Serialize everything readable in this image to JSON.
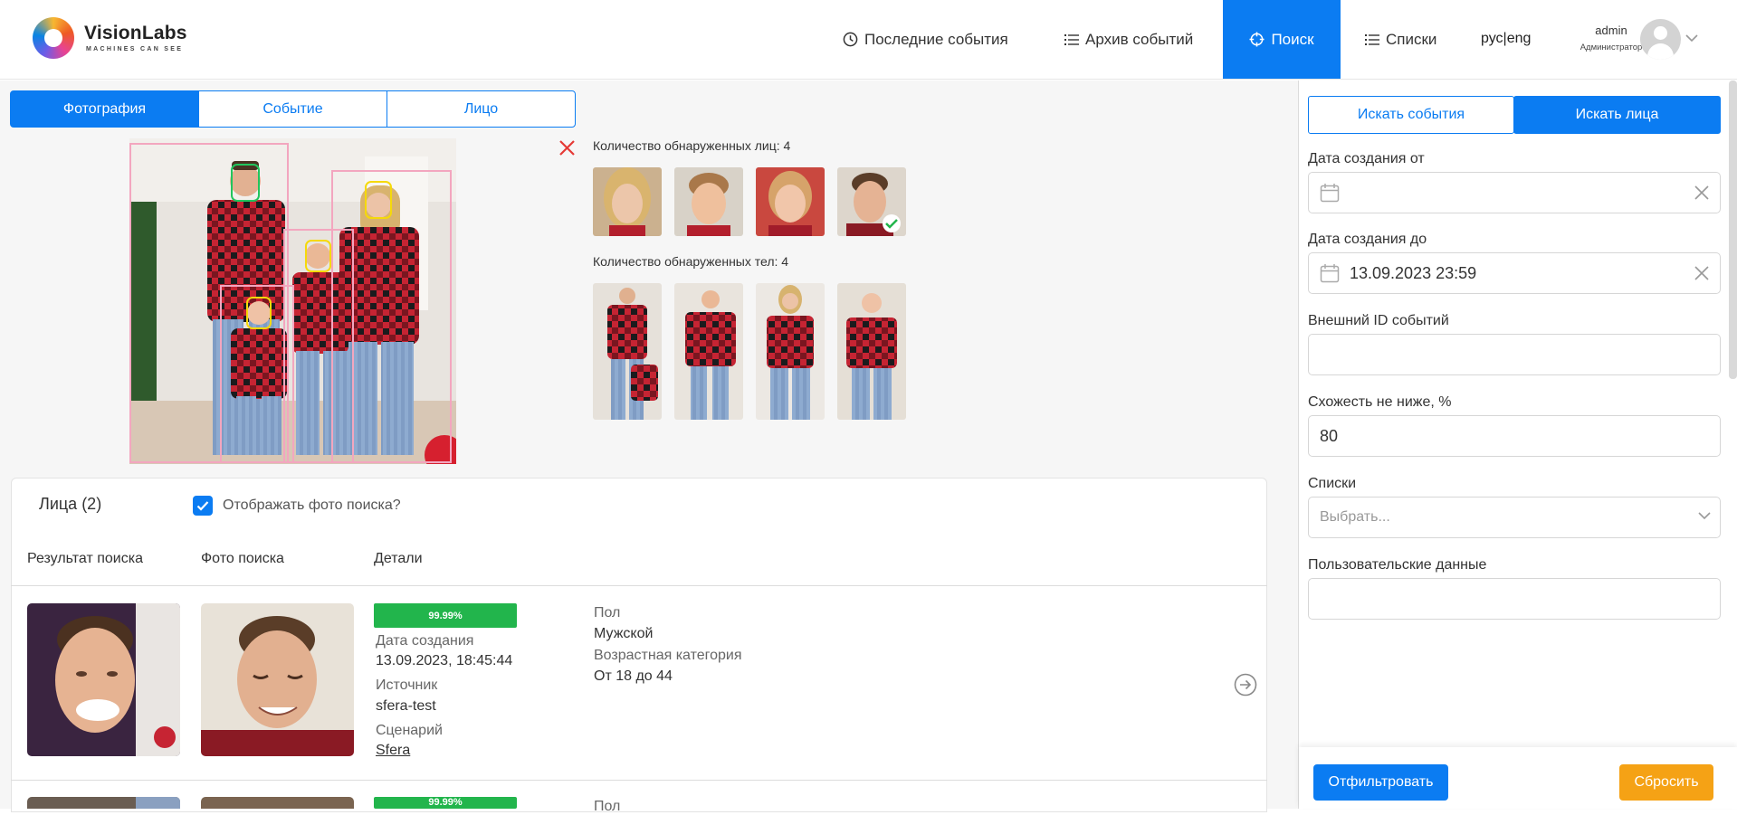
{
  "brand": {
    "name": "VisionLabs",
    "tagline": "MACHINES CAN SEE"
  },
  "nav": {
    "items": [
      {
        "label": "Последние события",
        "icon": "clock-icon"
      },
      {
        "label": "Архив событий",
        "icon": "list-icon"
      },
      {
        "label": "Поиск",
        "icon": "crosshair-icon",
        "active": true
      },
      {
        "label": "Списки",
        "icon": "list-icon"
      }
    ],
    "language": "рус|eng",
    "user": {
      "name": "admin",
      "role": "Администратор"
    }
  },
  "source_tabs": [
    {
      "label": "Фотография",
      "active": true
    },
    {
      "label": "Событие"
    },
    {
      "label": "Лицо"
    }
  ],
  "detection": {
    "faces_label": "Количество обнаруженных лиц: 4",
    "bodies_label": "Количество обнаруженных тел: 4"
  },
  "results": {
    "title": "Лица (2)",
    "show_photo_label": "Отображать фото поиска?",
    "show_photo_checked": true,
    "columns": [
      "Результат поиска",
      "Фото поиска",
      "Детали"
    ],
    "rows": [
      {
        "similarity": "99.99%",
        "created_label": "Дата создания",
        "created": "13.09.2023, 18:45:44",
        "source_label": "Источник",
        "source": "sfera-test",
        "scenario_label": "Сценарий",
        "scenario": "Sfera",
        "gender_label": "Пол",
        "gender": "Мужской",
        "age_label": "Возрастная категория",
        "age": "От 18 до 44"
      },
      {
        "similarity": "99.99%",
        "gender_label": "Пол"
      }
    ]
  },
  "search_panel": {
    "tabs": [
      {
        "label": "Искать события"
      },
      {
        "label": "Искать лица",
        "active": true
      }
    ],
    "fields": {
      "date_from_label": "Дата создания от",
      "date_from_value": "",
      "date_to_label": "Дата создания до",
      "date_to_value": "13.09.2023 23:59",
      "external_id_label": "Внешний ID событий",
      "external_id_value": "",
      "similarity_label": "Схожесть не ниже, %",
      "similarity_value": "80",
      "lists_label": "Списки",
      "lists_placeholder": "Выбрать...",
      "user_data_label": "Пользовательские данные",
      "user_data_value": ""
    },
    "filter_button": "Отфильтровать",
    "reset_button": "Сбросить"
  },
  "colors": {
    "accent": "#0b7cf2",
    "success": "#22b54c",
    "warning": "#f5a215",
    "danger": "#e53935"
  }
}
